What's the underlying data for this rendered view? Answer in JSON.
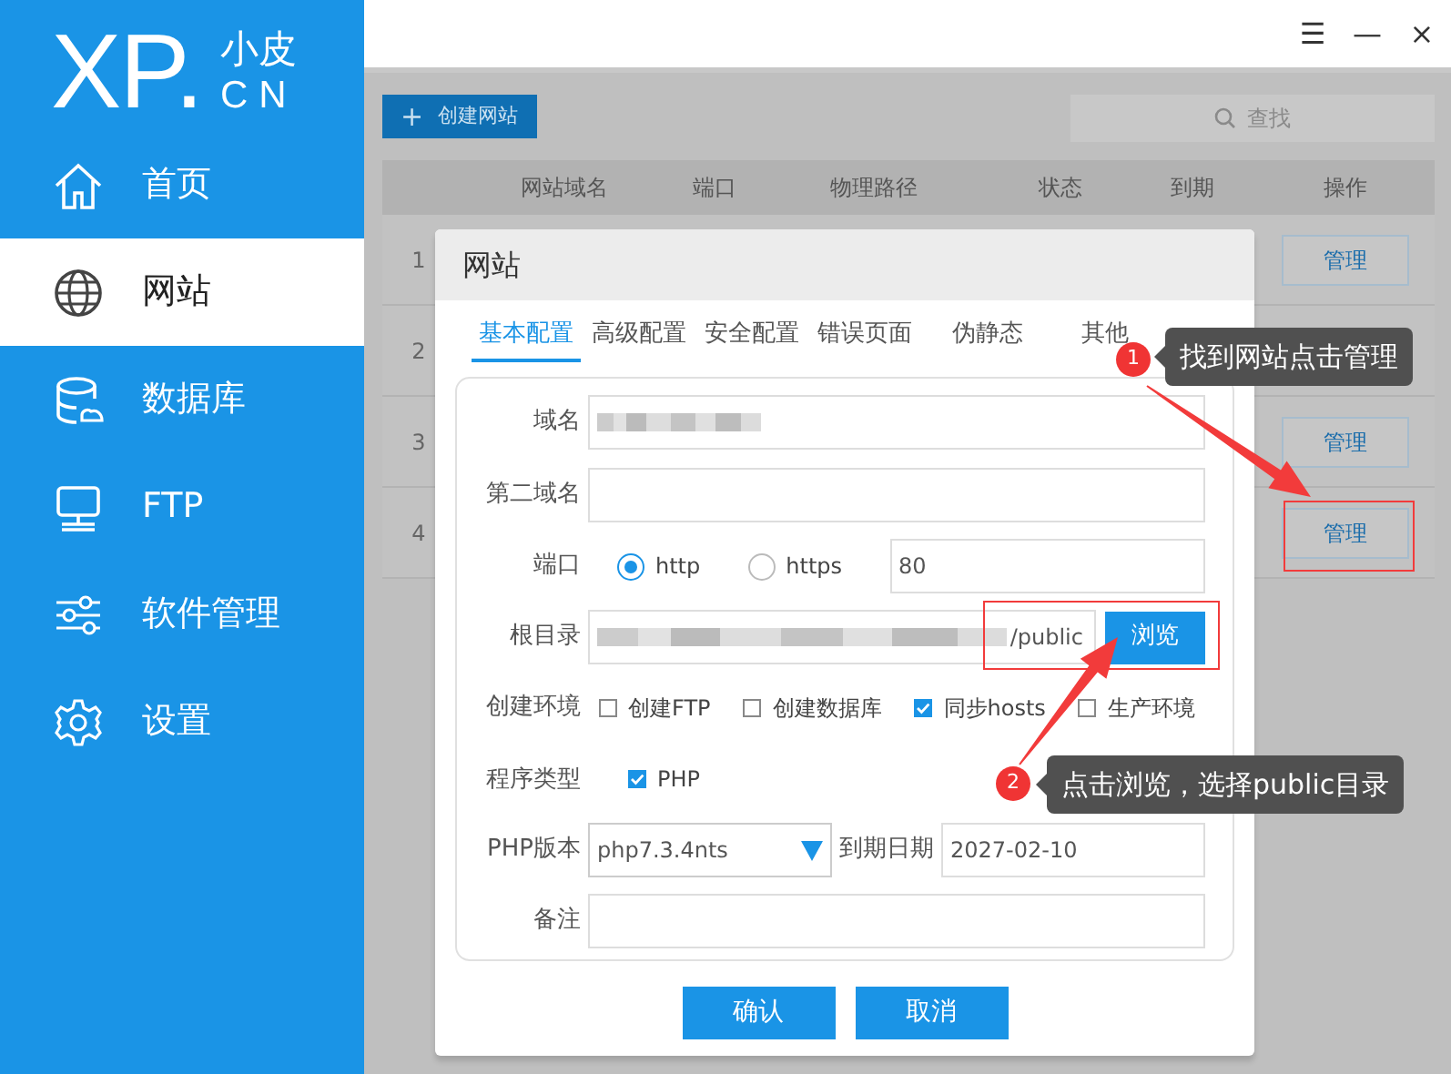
{
  "window": {
    "controls": [
      "☰",
      "—",
      "×"
    ]
  },
  "logo": {
    "mark": "XP.",
    "line_1": "小皮",
    "line_2": "CN"
  },
  "sidebar": {
    "items": [
      {
        "label": "首页",
        "kind": "home",
        "selected": false
      },
      {
        "label": "网站",
        "kind": "globe",
        "selected": true
      },
      {
        "label": "数据库",
        "kind": "database",
        "selected": false
      },
      {
        "label": "FTP",
        "kind": "monitor",
        "selected": false
      },
      {
        "label": "软件管理",
        "kind": "sliders",
        "selected": false
      },
      {
        "label": "设置",
        "kind": "gear",
        "selected": false
      }
    ]
  },
  "toolbar": {
    "create_button": {
      "icon": "+",
      "label": "创建网站"
    },
    "search": {
      "placeholder": "查找"
    }
  },
  "table": {
    "columns": [
      "网站域名",
      "端口",
      "物理路径",
      "状态",
      "到期",
      "操作"
    ],
    "rows": [
      {
        "index": "1",
        "action": "管理"
      },
      {
        "index": "2"
      },
      {
        "index": "3",
        "action": "管理"
      },
      {
        "index": "4",
        "action": "管理"
      }
    ]
  },
  "modal": {
    "title": "网站",
    "tabs": [
      {
        "label": "基本配置",
        "selected": true
      },
      {
        "label": "高级配置",
        "selected": false
      },
      {
        "label": "安全配置",
        "selected": false
      },
      {
        "label": "错误页面",
        "selected": false
      },
      {
        "label": "伪静态",
        "selected": false
      },
      {
        "label": "其他",
        "selected": false
      }
    ],
    "fields": [
      {
        "kind": "text",
        "label": "域名",
        "redacted": true
      },
      {
        "kind": "text",
        "label": "第二域名"
      },
      {
        "kind": "port",
        "label": "端口",
        "options": [
          {
            "label": "http",
            "selected": true
          },
          {
            "label": "https",
            "selected": false
          }
        ],
        "value": "80"
      },
      {
        "kind": "path",
        "label": "根目录",
        "redacted": true,
        "value": "/public",
        "button": "浏览"
      },
      {
        "kind": "checks",
        "label": "创建环境",
        "options": [
          {
            "label": "创建FTP",
            "checked": false
          },
          {
            "label": "创建数据库",
            "checked": false
          },
          {
            "label": "同步hosts",
            "checked": true
          },
          {
            "label": "生产环境",
            "checked": false
          }
        ]
      },
      {
        "kind": "checks",
        "label": "程序类型",
        "options": [
          {
            "label": "PHP",
            "checked": true
          }
        ]
      },
      {
        "kind": "select_date",
        "label": "PHP版本",
        "value": "php7.3.4nts",
        "date_label": "到期日期",
        "date": "2027-02-10"
      },
      {
        "kind": "text",
        "label": "备注"
      }
    ],
    "buttons": [
      "确认",
      "取消"
    ]
  },
  "annotations": [
    {
      "number": "1",
      "text": "找到网站点击管理"
    },
    {
      "number": "2",
      "text": "点击浏览，选择public目录"
    }
  ]
}
